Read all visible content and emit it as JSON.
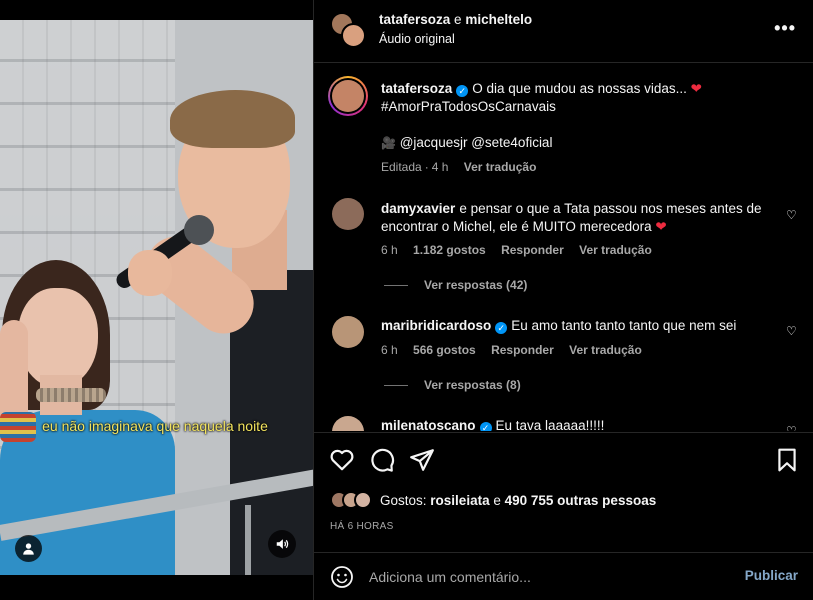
{
  "video": {
    "caption": "eu não imaginava que naquela noite",
    "icons": {
      "user_tag": "person-icon",
      "sound": "speaker-icon"
    }
  },
  "header": {
    "user1": "tatafersoza",
    "joiner": "e",
    "user2": "micheltelo",
    "audio": "Áudio original",
    "more": "•••"
  },
  "caption_post": {
    "user": "tatafersoza",
    "text": "O dia que mudou as nossas vidas...",
    "heart": "❤",
    "hashtag": "#AmorPraTodosOsCarnavais",
    "camera": "🎥",
    "mentions": "@jacquesjr @sete4oficial",
    "edited": "Editada",
    "time": "4 h",
    "translate": "Ver tradução"
  },
  "comments": [
    {
      "user": "damyxavier",
      "verified": false,
      "text": "e pensar o que a Tata passou nos meses antes de encontrar o Michel, ele é MUITO merecedora",
      "heart": "❤",
      "time": "6 h",
      "likes": "1.182 gostos",
      "reply": "Responder",
      "translate": "Ver tradução",
      "replies": "Ver respostas (42)"
    },
    {
      "user": "maribridicardoso",
      "verified": true,
      "text": "Eu amo tanto tanto tanto que nem sei",
      "time": "6 h",
      "likes": "566 gostos",
      "reply": "Responder",
      "translate": "Ver tradução",
      "replies": "Ver respostas (8)"
    },
    {
      "user": "milenatoscano",
      "verified": true,
      "text": "Eu tava laaaaa!!!!!"
    }
  ],
  "actions": {
    "likes_label": "Gostos:",
    "liked_by": "rosileiata",
    "and": "e",
    "others": "490 755 outras pessoas",
    "time_ago": "HÁ 6 HORAS"
  },
  "add_comment": {
    "placeholder": "Adiciona um comentário...",
    "publish": "Publicar"
  },
  "colors": {
    "accent": "#0095f6",
    "heart_red": "#ed2b3f",
    "publish": "#85a8c9",
    "caption_yellow": "#f2e35e"
  }
}
